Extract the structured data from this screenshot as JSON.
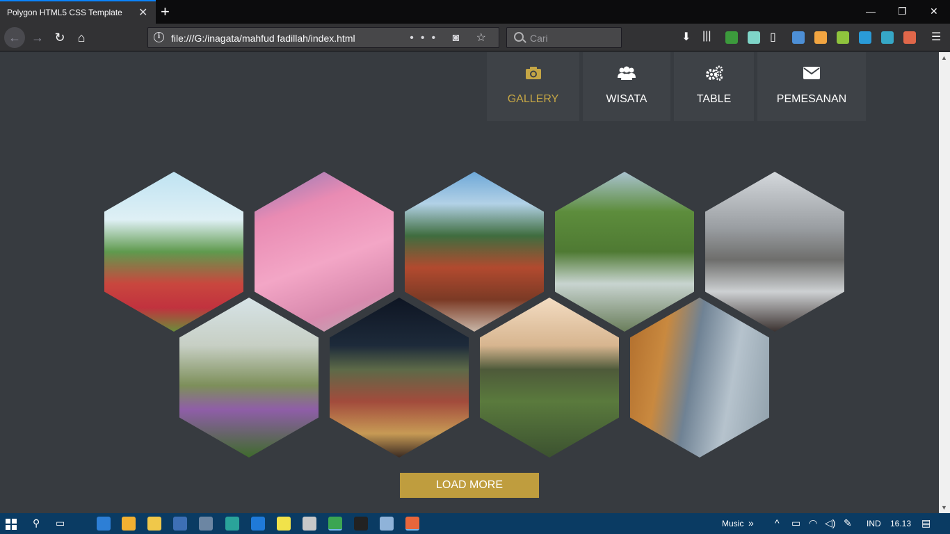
{
  "browser": {
    "tab_title": "Polygon HTML5 CSS Template",
    "url": "file:///G:/inagata/mahfud fadillah/index.html",
    "search_placeholder": "Cari"
  },
  "nav": [
    {
      "label": "GALLERY",
      "icon": "camera-icon",
      "active": true
    },
    {
      "label": "WISATA",
      "icon": "users-icon",
      "active": false
    },
    {
      "label": "TABLE",
      "icon": "gears-icon",
      "active": false
    },
    {
      "label": "PEMESANAN",
      "icon": "envelope-icon",
      "active": false
    }
  ],
  "gallery": {
    "row1": [
      "tulip-garden-photo",
      "umbrella-mural-photo",
      "pagoda-temple-photo",
      "waterfall-valley-photo",
      "bromo-mountain-photo"
    ],
    "row2": [
      "flower-park-photo",
      "night-market-photo",
      "hill-scooter-photo",
      "forest-balcony-photo"
    ]
  },
  "load_more_label": "LOAD MORE",
  "taskbar": {
    "music_label": "Music",
    "language": "IND",
    "time": "16.13"
  },
  "colors": {
    "accent": "#bf9d3e",
    "page_bg": "#373b40",
    "menu_bg": "#3e4247",
    "active_text": "#c5a645"
  }
}
